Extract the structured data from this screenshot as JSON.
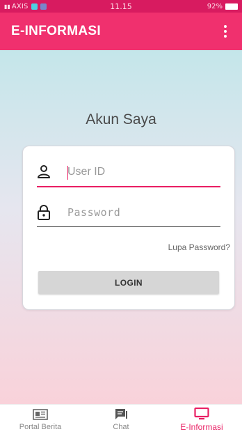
{
  "status_bar": {
    "carrier": "AXIS",
    "time": "11.15",
    "battery": "92%"
  },
  "app_bar": {
    "title": "E-INFORMASI",
    "menu_icon": "more-vertical-icon"
  },
  "main": {
    "title": "Akun Saya",
    "user_field": {
      "placeholder": "User ID",
      "value": "",
      "icon": "person-icon"
    },
    "password_field": {
      "placeholder": "Password",
      "value": "",
      "icon": "lock-icon"
    },
    "forgot_password": "Lupa Password?",
    "login_label": "LOGIN"
  },
  "bottom_nav": {
    "items": [
      {
        "label": "Portal Berita",
        "icon": "newspaper-icon"
      },
      {
        "label": "Chat",
        "icon": "chat-icon"
      },
      {
        "label": "E-Informasi",
        "icon": "monitor-icon",
        "active": true
      }
    ]
  },
  "colors": {
    "status_bar": "#d81b60",
    "app_bar": "#f0306e",
    "accent": "#e91e63",
    "login_button": "#d6d6d6"
  }
}
